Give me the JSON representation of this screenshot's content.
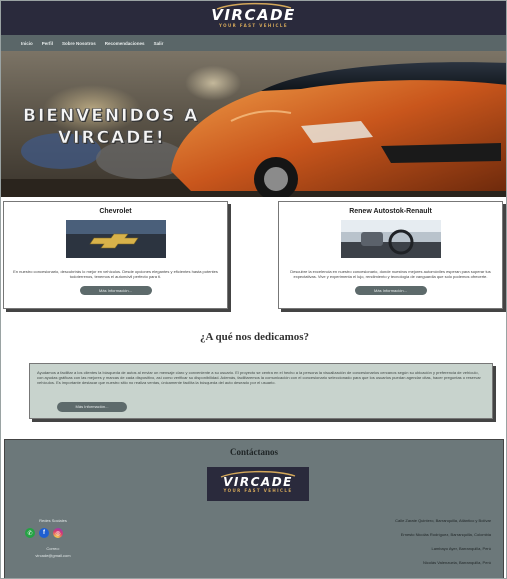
{
  "header": {
    "logo_text": "VIRCADE",
    "logo_tagline": "YOUR FAST VEHICLE"
  },
  "nav": {
    "items": [
      "Inicio",
      "Perfil",
      "Sobre Nosotros",
      "Recomendaciones",
      "Salir"
    ]
  },
  "hero": {
    "title_line1": "BIENVENIDOS A",
    "title_line2": "VIRCADE!"
  },
  "cards": [
    {
      "title": "Chevrolet",
      "description": "En nuestro concesionario, descubrirás lo mejor en vehículos. Desde opciones elegantes y eficientes hasta potentes todoterrenos, tenemos el automóvil perfecto para ti.",
      "button": "Más Información..."
    },
    {
      "title": "Renew Autostok-Renault",
      "description": "Descubre la excelencia en nuestro concesionario, donde nuestros mejores automóviles esperan para superar tus expectativas. Vive y experimenta el lujo, rendimiento y tecnología de vanguardia que solo podemos ofrecerte.",
      "button": "Más Información..."
    }
  ],
  "mission": {
    "title": "¿A qué nos dedicamos?",
    "text": "Ayudamos a facilitar a los clientes la búsqueda de autos al enviar un mensaje claro y conveniente a su usuario. El proyecto se centra en el hecho a la persona la visualización de concesionarios cercanos según su ubicación y preferencia de vehículo, con ayudas gráficas con las mejores y marcas de cada dispositivo, así como verificar su disponibilidad. Además, facilitaremos la comunicación con el concesionario seleccionado para que los usuarios puedan agendar citas, hacer preguntas o reservar vehículos. Es importante destacar que nuestro sitio no realiza ventas, únicamente facilita la búsqueda del auto deseado por el usuario.",
    "button": "Más Información..."
  },
  "footer": {
    "title": "Contáctanos",
    "social_label": "Redes Sociales",
    "email_label": "Correo:",
    "email": "vircade@gmail.com",
    "addresses": [
      "Calle Zarate Quintero, Barranquilla, Atlántico y Bolívar",
      "Ernesto Nicolás Rodríguez, Barranquilla, Colombia",
      "Lambayo Ayer, Barranquilla, Perú",
      "Nicolás Valenzuela, Barranquilla, Perú"
    ]
  },
  "colors": {
    "header_bg": "#2a2a3c",
    "nav_bg": "#5a6668",
    "button_bg": "#5d6a6b",
    "mission_bg": "#c8d3cd",
    "footer_bg": "#6c787a",
    "logo_accent": "#d4a85a"
  },
  "icons": {
    "whatsapp": "whatsapp-icon",
    "facebook": "facebook-icon",
    "instagram": "instagram-icon"
  }
}
